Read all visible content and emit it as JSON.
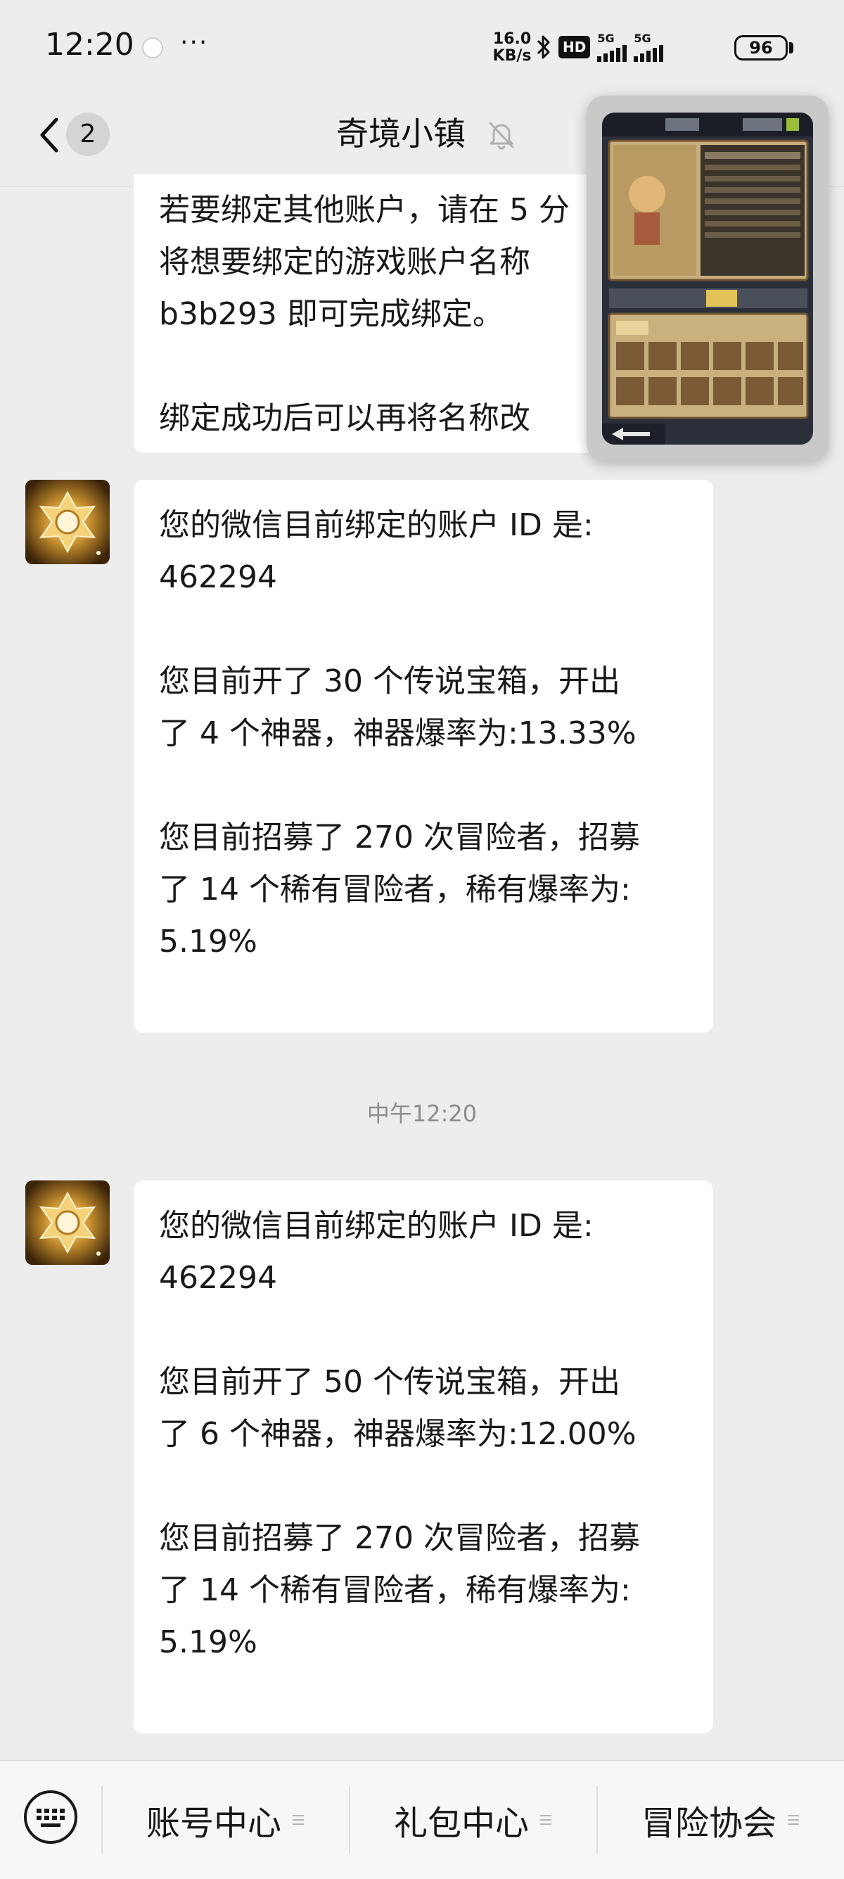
{
  "status_bar": {
    "time": "12:20",
    "more": "···",
    "speed_value": "16.0",
    "speed_unit": "KB/s",
    "hd_label": "HD",
    "network_1": "5G",
    "network_2": "5G",
    "battery": "96"
  },
  "header": {
    "unread_count": "2",
    "title": "奇境小镇"
  },
  "messages": [
    {
      "text": "若要绑定其他账户，请在 5 分\n将想要绑定的游戏账户名称\nb3b293 即可完成绑定。\n\n绑定成功后可以再将名称改"
    },
    {
      "text": "您的微信目前绑定的账户 ID 是:\n462294\n\n您目前开了 30 个传说宝箱，开出\n了 4 个神器，神器爆率为:13.33%\n\n您目前招募了 270 次冒险者，招募\n了 14 个稀有冒险者，稀有爆率为:\n5.19%"
    },
    {
      "text": "您的微信目前绑定的账户 ID 是:\n462294\n\n您目前开了 50 个传说宝箱，开出\n了 6 个神器，神器爆率为:12.00%\n\n您目前招募了 270 次冒险者，招募\n了 14 个稀有冒险者，稀有爆率为:\n5.19%"
    }
  ],
  "timestamp": "中午12:20",
  "bottom_menu": [
    {
      "label": "账号中心",
      "icon": "menu-lines-icon"
    },
    {
      "label": "礼包中心",
      "icon": "menu-lines-icon"
    },
    {
      "label": "冒险协会",
      "icon": "menu-lines-icon"
    }
  ],
  "icons": {
    "back": "chevron-left-icon",
    "mute": "bell-off-icon",
    "keyboard": "keyboard-icon",
    "avatar": "golden-emblem-avatar"
  },
  "colors": {
    "background": "#ededed",
    "bubble": "#ffffff",
    "timestamp_text": "#8d8d8d",
    "bottom_bar": "#f7f7f7"
  }
}
